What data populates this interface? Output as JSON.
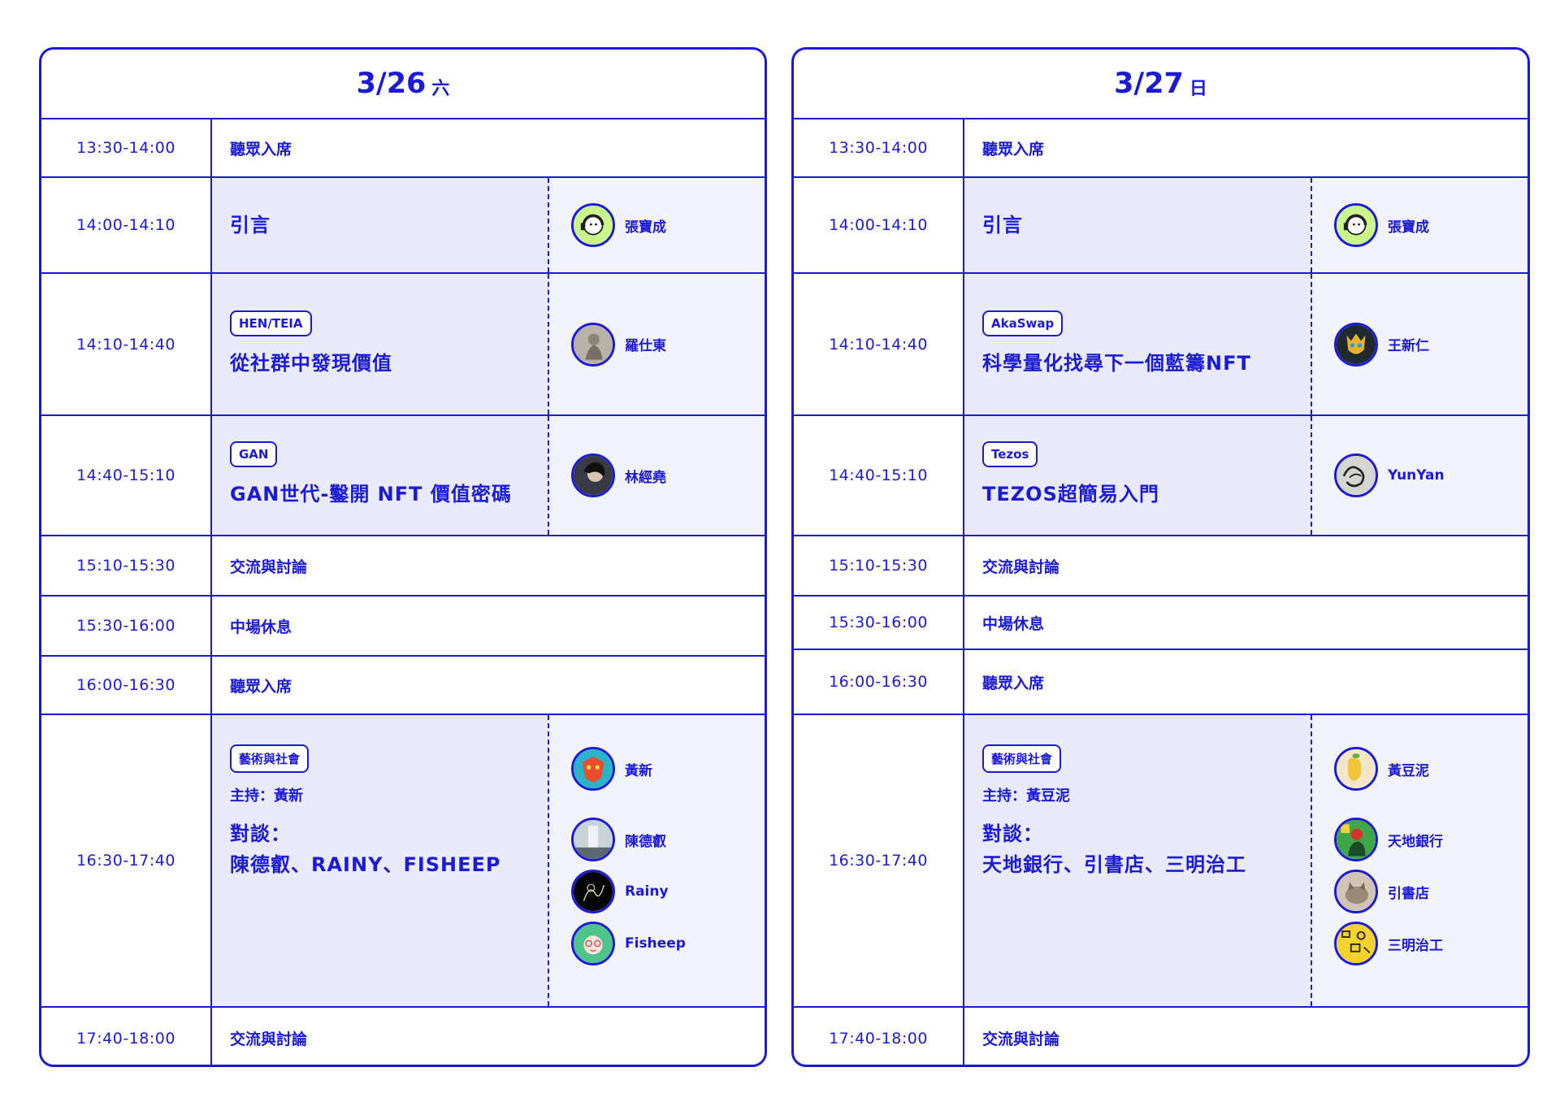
{
  "days": [
    {
      "date": "3/26",
      "weekday": "六",
      "rows": [
        {
          "time": "13:30-14:00",
          "label": "聽眾入席"
        },
        {
          "time": "14:00-14:10",
          "title": "引言",
          "speakers": [
            {
              "name": "張寶成",
              "icon": "headphone-character-avatar"
            }
          ]
        },
        {
          "time": "14:10-14:40",
          "tag": "HEN/TEIA",
          "title": "從社群中發現價值",
          "speakers": [
            {
              "name": "羅仕東",
              "icon": "statue-avatar"
            }
          ]
        },
        {
          "time": "14:40-15:10",
          "tag": "GAN",
          "title": "GAN世代-鑿開 NFT 價值密碼",
          "speakers": [
            {
              "name": "林經堯",
              "icon": "portrait-avatar"
            }
          ]
        },
        {
          "time": "15:10-15:30",
          "label": "交流與討論"
        },
        {
          "time": "15:30-16:00",
          "label": "中場休息"
        },
        {
          "time": "16:00-16:30",
          "label": "聽眾入席"
        },
        {
          "time": "16:30-17:40",
          "tag": "藝術與社會",
          "host": "主持：黃新",
          "title_line1": "對談：",
          "title_line2": "陳德叡、RAINY、FISHEEP",
          "speakers": [
            {
              "name": "黃新",
              "icon": "mask-avatar"
            },
            {
              "name": "陳德叡",
              "icon": "tower-avatar"
            },
            {
              "name": "Rainy",
              "icon": "line-drawing-avatar"
            },
            {
              "name": "Fisheep",
              "icon": "cartoon-girl-avatar"
            }
          ]
        },
        {
          "time": "17:40-18:00",
          "label": "交流與討論"
        }
      ]
    },
    {
      "date": "3/27",
      "weekday": "日",
      "rows": [
        {
          "time": "13:30-14:00",
          "label": "聽眾入席"
        },
        {
          "time": "14:00-14:10",
          "title": "引言",
          "speakers": [
            {
              "name": "張寶成",
              "icon": "headphone-character-avatar"
            }
          ]
        },
        {
          "time": "14:10-14:40",
          "tag": "AkaSwap",
          "title": "科學量化找尋下一個藍籌NFT",
          "speakers": [
            {
              "name": "王新仁",
              "icon": "creature-avatar"
            }
          ]
        },
        {
          "time": "14:40-15:10",
          "tag": "Tezos",
          "title": "TEZOS超簡易入門",
          "speakers": [
            {
              "name": "YunYan",
              "icon": "sketch-avatar"
            }
          ]
        },
        {
          "time": "15:10-15:30",
          "label": "交流與討論"
        },
        {
          "time": "15:30-16:00",
          "label": "中場休息"
        },
        {
          "time": "16:00-16:30",
          "label": "聽眾入席"
        },
        {
          "time": "16:30-17:40",
          "tag": "藝術與社會",
          "host": "主持：黃豆泥",
          "title_line1": "對談：",
          "title_line2": "天地銀行、引書店、三明治工",
          "speakers": [
            {
              "name": "黃豆泥",
              "icon": "bean-avatar"
            },
            {
              "name": "天地銀行",
              "icon": "green-figure-avatar"
            },
            {
              "name": "引書店",
              "icon": "cat-avatar"
            },
            {
              "name": "三明治工",
              "icon": "yellow-pattern-avatar"
            }
          ]
        },
        {
          "time": "17:40-18:00",
          "label": "交流與討論"
        }
      ]
    }
  ]
}
